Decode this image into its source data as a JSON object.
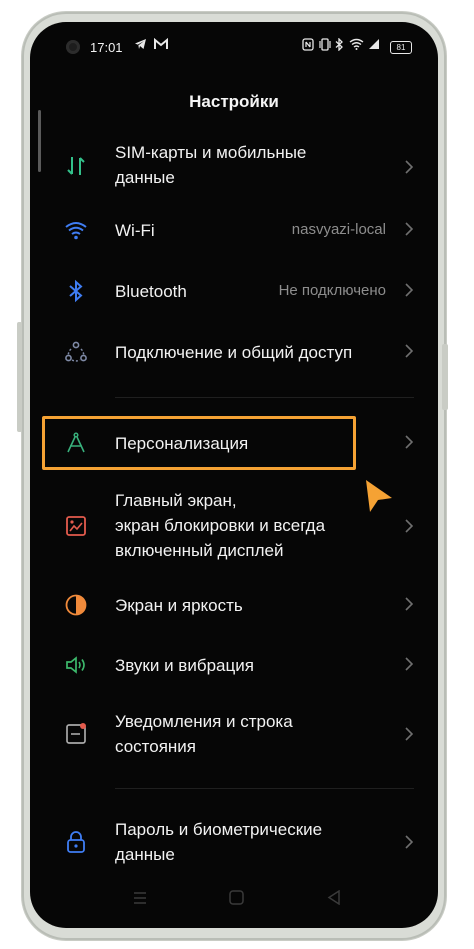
{
  "status_bar": {
    "time": "17:01",
    "battery": "81"
  },
  "header": {
    "title": "Настройки"
  },
  "settings": [
    {
      "label_lines": [
        "SIM-карты и мобильные",
        "данные"
      ],
      "value": "",
      "icon": "sim-data-icon",
      "icon_color": "#32c08a"
    },
    {
      "label_lines": [
        "Wi-Fi"
      ],
      "value": "nasvyazi-local",
      "icon": "wifi-icon",
      "icon_color": "#3f7df3"
    },
    {
      "label_lines": [
        "Bluetooth"
      ],
      "value": "Не подключено",
      "icon": "bluetooth-icon",
      "icon_color": "#3f7df3"
    },
    {
      "label_lines": [
        "Подключение и общий доступ"
      ],
      "value": "",
      "icon": "connection-share-icon",
      "icon_color": "#7f8aa6"
    },
    {
      "label_lines": [
        "Персонализация"
      ],
      "value": "",
      "icon": "personalization-icon",
      "icon_color": "#38b07c"
    },
    {
      "label_lines": [
        "Главный экран,",
        "экран блокировки и всегда",
        "включенный дисплей"
      ],
      "value": "",
      "icon": "home-lockscreen-icon",
      "icon_color": "#e35b4d"
    },
    {
      "label_lines": [
        "Экран и яркость"
      ],
      "value": "",
      "icon": "display-brightness-icon",
      "icon_color": "#f08a3b"
    },
    {
      "label_lines": [
        "Звуки и вибрация"
      ],
      "value": "",
      "icon": "sound-vibration-icon",
      "icon_color": "#3cb86b"
    },
    {
      "label_lines": [
        "Уведомления и строка",
        "состояния"
      ],
      "value": "",
      "icon": "notifications-icon",
      "icon_color": "#a9a9a9"
    },
    {
      "label_lines": [
        "Пароль и биометрические",
        "данные"
      ],
      "value": "",
      "icon": "password-biometrics-icon",
      "icon_color": "#3f7df3"
    }
  ],
  "highlight_color": "#f5a234"
}
